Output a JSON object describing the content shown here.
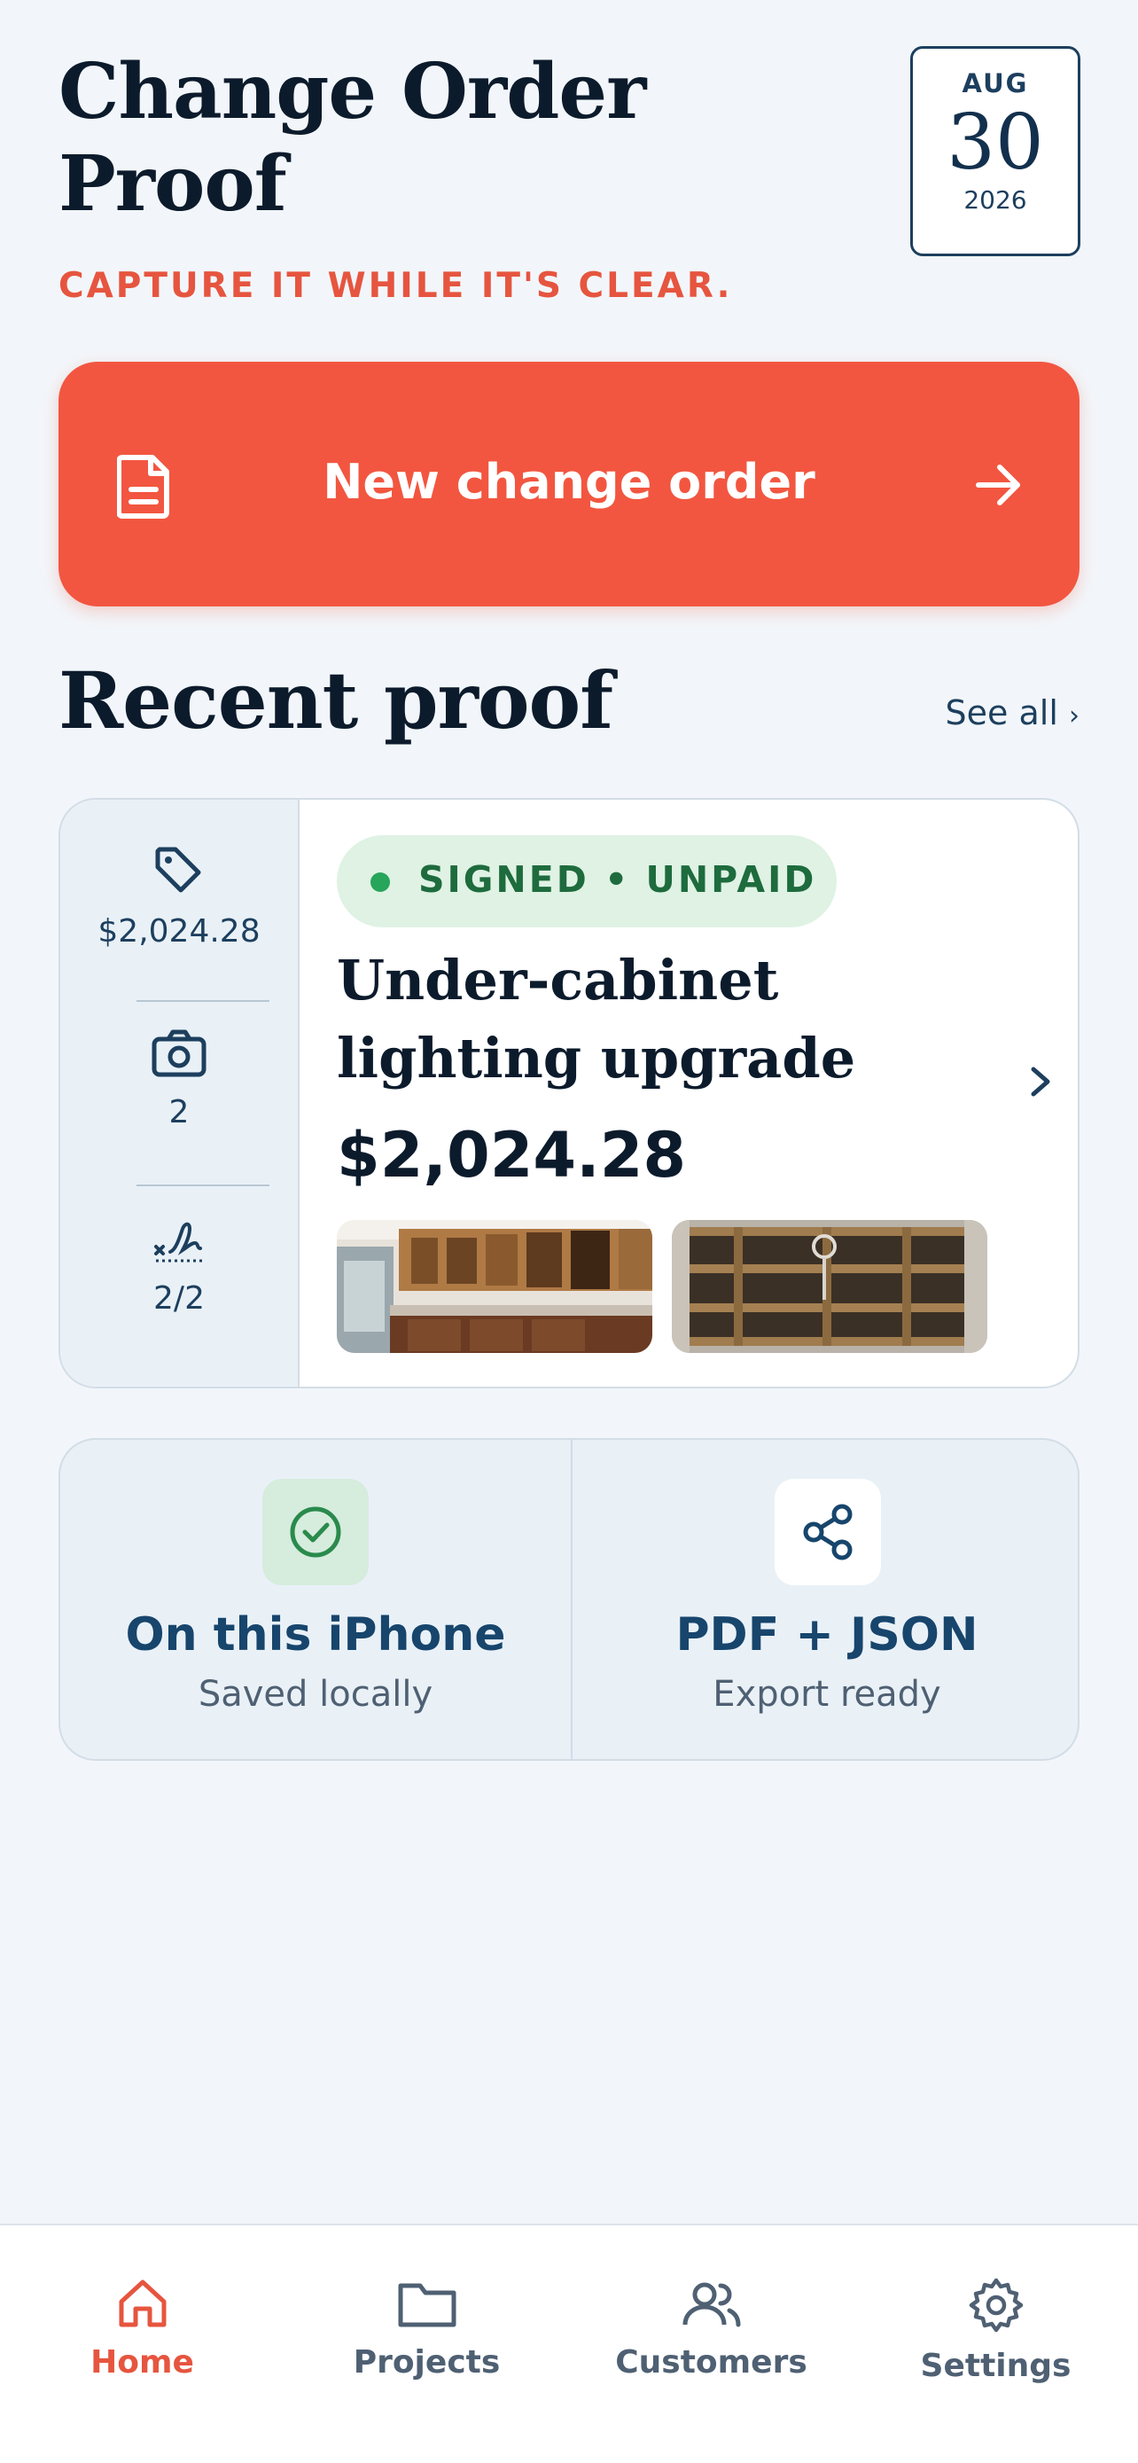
{
  "header": {
    "title": "Change Order Proof",
    "tagline": "CAPTURE IT WHILE IT'S CLEAR."
  },
  "date": {
    "month": "AUG",
    "day": "30",
    "year": "2026"
  },
  "cta": {
    "label": "New change order",
    "icon": "document-icon",
    "arrow_icon": "arrow-right-icon"
  },
  "recent": {
    "title": "Recent proof",
    "see_all": "See all",
    "card": {
      "status": "SIGNED • UNPAID",
      "title": "Under-cabinet lighting upgrade",
      "amount": "$2,024.28",
      "side": {
        "price": "$2,024.28",
        "photos": "2",
        "signatures": "2/2"
      },
      "thumbnails": [
        "kitchen-cabinets-photo",
        "floor-joists-photo"
      ]
    }
  },
  "tiles": [
    {
      "title": "On this iPhone",
      "subtitle": "Saved locally",
      "icon": "check-circle-icon"
    },
    {
      "title": "PDF + JSON",
      "subtitle": "Export ready",
      "icon": "share-icon"
    }
  ],
  "tabs": [
    {
      "label": "Home",
      "icon": "home-icon",
      "active": true
    },
    {
      "label": "Projects",
      "icon": "folder-icon"
    },
    {
      "label": "Customers",
      "icon": "users-icon"
    },
    {
      "label": "Settings",
      "icon": "gear-icon"
    }
  ],
  "colors": {
    "background": "#f2f6fa",
    "accent": "#f25640",
    "navy": "#0c1b2c",
    "success_bg": "#dff2e4",
    "success_text": "#1e6b3d"
  }
}
